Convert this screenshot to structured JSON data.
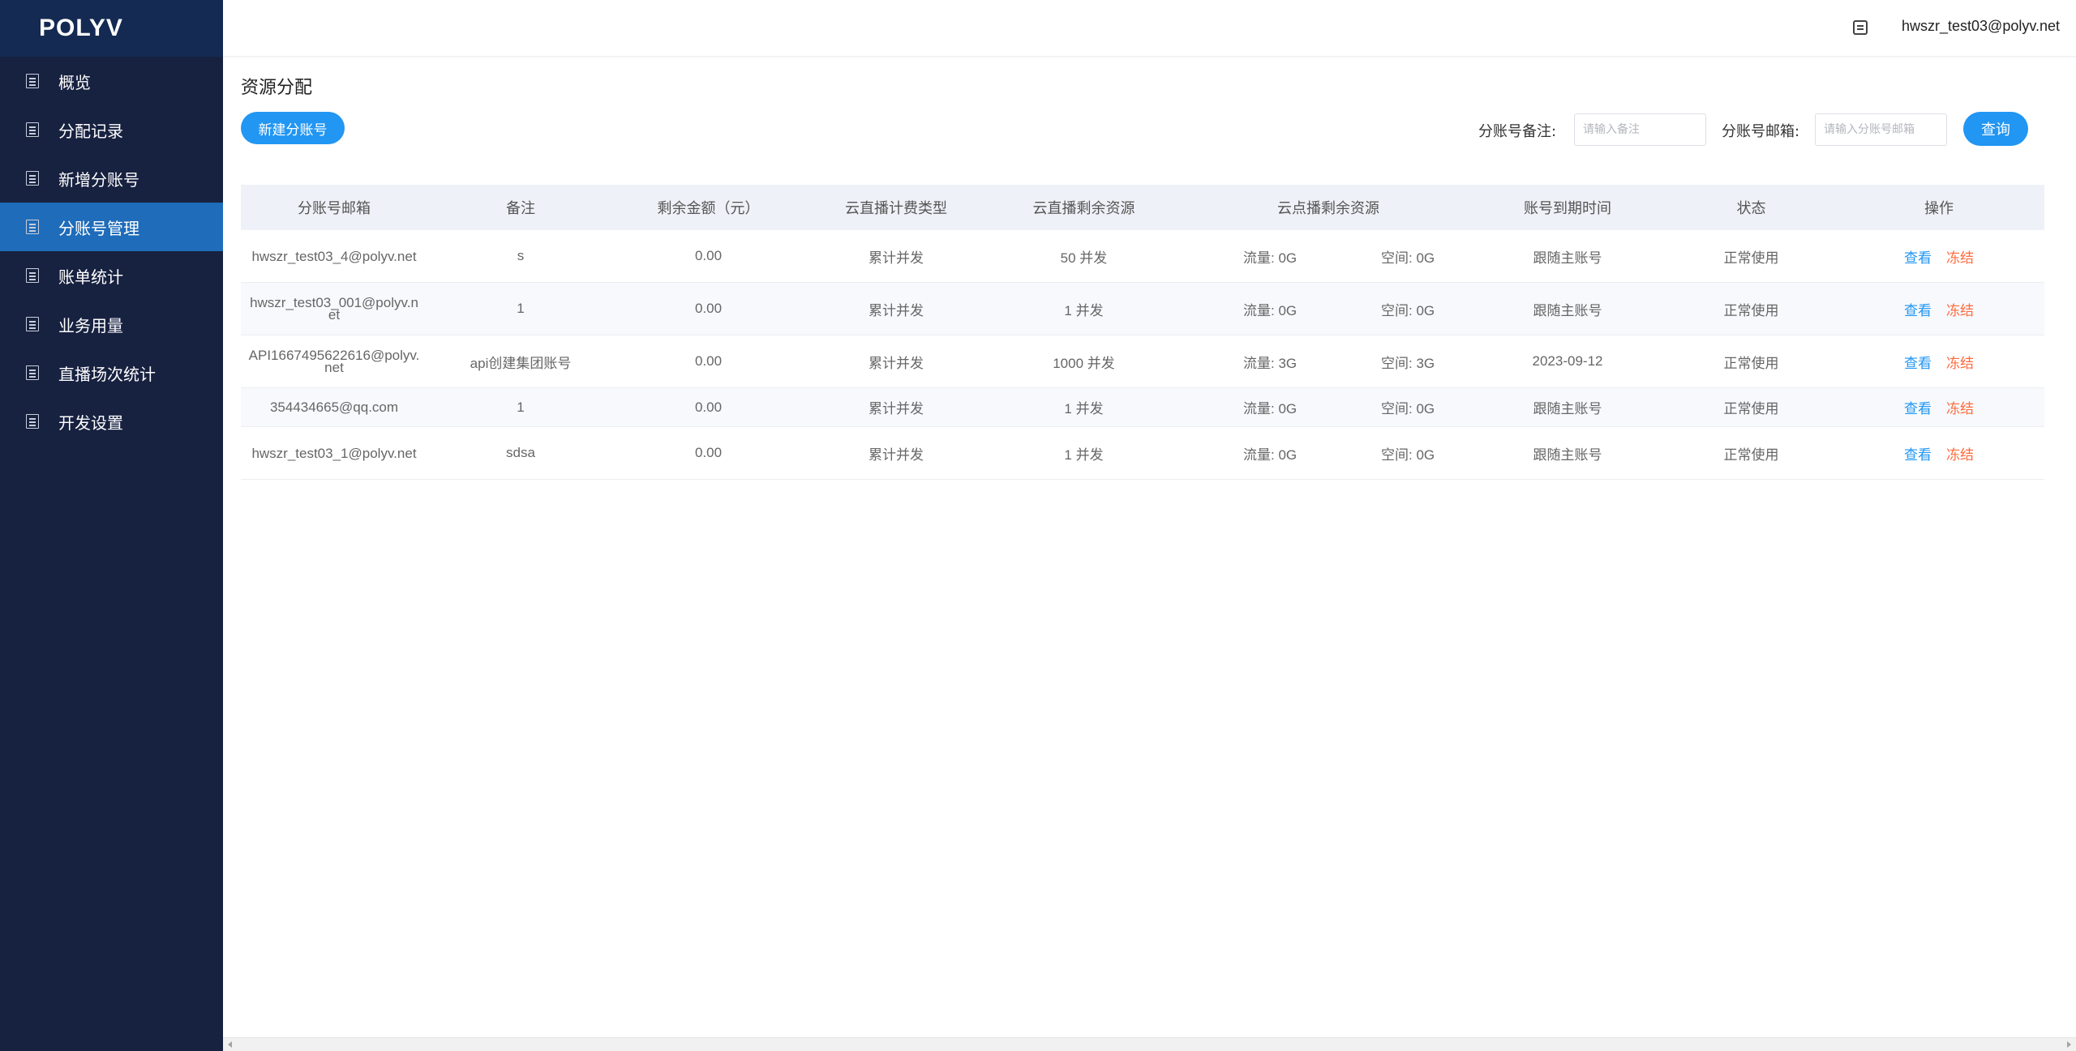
{
  "brand": {
    "logo_text": "POLYV"
  },
  "sidebar": {
    "items": [
      {
        "label": "概览",
        "active": false
      },
      {
        "label": "分配记录",
        "active": false
      },
      {
        "label": "新增分账号",
        "active": false
      },
      {
        "label": "分账号管理",
        "active": true
      },
      {
        "label": "账单统计",
        "active": false
      },
      {
        "label": "业务用量",
        "active": false
      },
      {
        "label": "直播场次统计",
        "active": false
      },
      {
        "label": "开发设置",
        "active": false
      }
    ]
  },
  "header": {
    "user_email": "hwszr_test03@polyv.net"
  },
  "main": {
    "title": "资源分配",
    "new_button": "新建分账号",
    "filters": {
      "remark_label": "分账号备注:",
      "remark_placeholder": "请输入备注",
      "email_label": "分账号邮箱:",
      "email_placeholder": "请输入分账号邮箱",
      "query_button": "查询"
    }
  },
  "table": {
    "headers": [
      "分账号邮箱",
      "备注",
      "剩余金额（元）",
      "云直播计费类型",
      "云直播剩余资源",
      "云点播剩余资源",
      "账号到期时间",
      "状态",
      "操作"
    ],
    "action_view": "查看",
    "action_freeze": "冻结",
    "rows": [
      {
        "email": "hwszr_test03_4@polyv.net",
        "remark": "s",
        "balance": "0.00",
        "billing": "累计并发",
        "live_res": "50 并发",
        "traffic": "流量: 0G",
        "space": "空间: 0G",
        "expire": "跟随主账号",
        "status": "正常使用"
      },
      {
        "email": "hwszr_test03_001@polyv.net",
        "remark": "1",
        "balance": "0.00",
        "billing": "累计并发",
        "live_res": "1 并发",
        "traffic": "流量: 0G",
        "space": "空间: 0G",
        "expire": "跟随主账号",
        "status": "正常使用"
      },
      {
        "email": "API1667495622616@polyv.net",
        "remark": "api创建集团账号",
        "balance": "0.00",
        "billing": "累计并发",
        "live_res": "1000 并发",
        "traffic": "流量: 3G",
        "space": "空间: 3G",
        "expire": "2023-09-12",
        "status": "正常使用"
      },
      {
        "email": "354434665@qq.com",
        "remark": "1",
        "balance": "0.00",
        "billing": "累计并发",
        "live_res": "1 并发",
        "traffic": "流量: 0G",
        "space": "空间: 0G",
        "expire": "跟随主账号",
        "status": "正常使用"
      },
      {
        "email": "hwszr_test03_1@polyv.net",
        "remark": "sdsa",
        "balance": "0.00",
        "billing": "累计并发",
        "live_res": "1 并发",
        "traffic": "流量: 0G",
        "space": "空间: 0G",
        "expire": "跟随主账号",
        "status": "正常使用"
      }
    ]
  },
  "colors": {
    "sidebar_bg": "#172140",
    "sidebar_active": "#1f6cba",
    "primary": "#2196f3",
    "danger": "#ff6a3c"
  }
}
